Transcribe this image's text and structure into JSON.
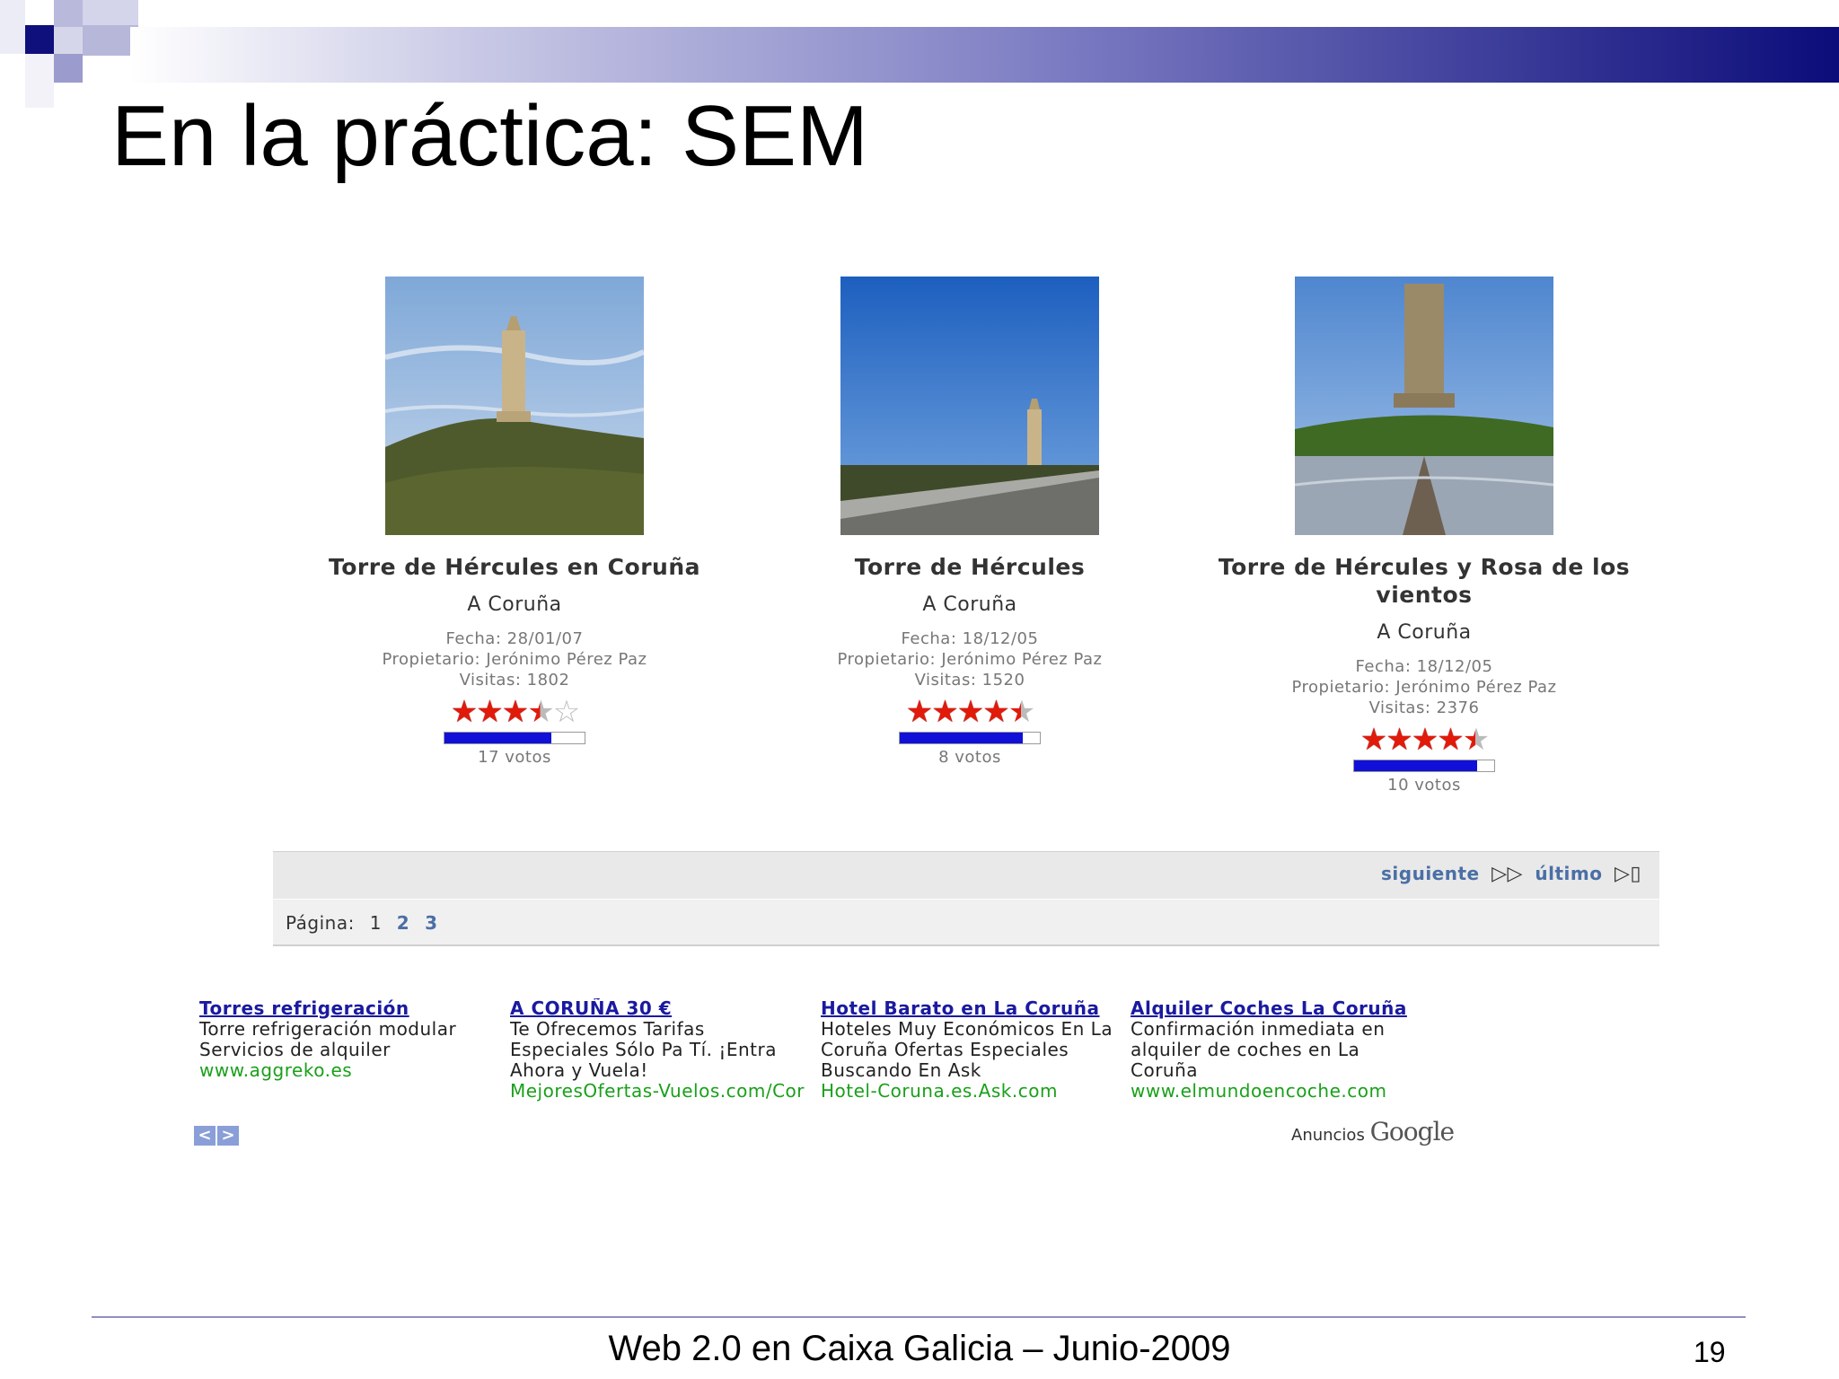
{
  "slide": {
    "title": "En la práctica: SEM",
    "footer": "Web 2.0 en Caixa Galicia – Junio-2009",
    "page_number": "19"
  },
  "photos": [
    {
      "title": "Torre de Hércules en Coruña",
      "location": "A Coruña",
      "date": "Fecha: 28/01/07",
      "owner": "Propietario: Jerónimo Pérez Paz",
      "visits": "Visitas: 1802",
      "rating_stars": 3.5,
      "rating_fill": 0.76,
      "votes": "17 votos"
    },
    {
      "title": "Torre de Hércules",
      "location": "A Coruña",
      "date": "Fecha: 18/12/05",
      "owner": "Propietario: Jerónimo Pérez Paz",
      "visits": "Visitas: 1520",
      "rating_stars": 4.5,
      "rating_fill": 0.88,
      "votes": "8 votos"
    },
    {
      "title": "Torre de Hércules y Rosa de los vientos",
      "location": "A Coruña",
      "date": "Fecha: 18/12/05",
      "owner": "Propietario: Jerónimo Pérez Paz",
      "visits": "Visitas: 2376",
      "rating_stars": 4.5,
      "rating_fill": 0.88,
      "votes": "10 votos"
    }
  ],
  "pager": {
    "next_label": "siguiente",
    "last_label": "último",
    "page_label": "Página:",
    "pages": [
      "1",
      "2",
      "3"
    ],
    "current_page": "1"
  },
  "ads": [
    {
      "title": "Torres refrigeración",
      "lines": [
        "Torre refrigeración modular",
        "Servicios de alquiler"
      ],
      "url": "www.aggreko.es"
    },
    {
      "title": "A CORUÑA 30 €",
      "lines": [
        "Te Ofrecemos Tarifas",
        "Especiales Sólo Pa Tí. ¡Entra",
        "Ahora y Vuela!"
      ],
      "url": "MejoresOfertas-Vuelos.com/Cor"
    },
    {
      "title": "Hotel Barato en La Coruña",
      "lines": [
        "Hoteles Muy Económicos En La",
        "Coruña Ofertas Especiales",
        "Buscando En Ask"
      ],
      "url": "Hotel-Coruna.es.Ask.com"
    },
    {
      "title": "Alquiler Coches La Coruña",
      "lines": [
        "Confirmación inmediata en",
        "alquiler de coches en La",
        "Coruña"
      ],
      "url": "www.elmundoencoche.com"
    }
  ],
  "ads_branding": {
    "prefix": "Anuncios",
    "brand": "Google"
  },
  "colors": {
    "header_dark": "#0c0c7a",
    "star": "#e11a0a",
    "rating_bar": "#1010d8",
    "link": "#4a6fa5",
    "ad_title": "#1a1aa0",
    "ad_url": "#1aa01a"
  }
}
